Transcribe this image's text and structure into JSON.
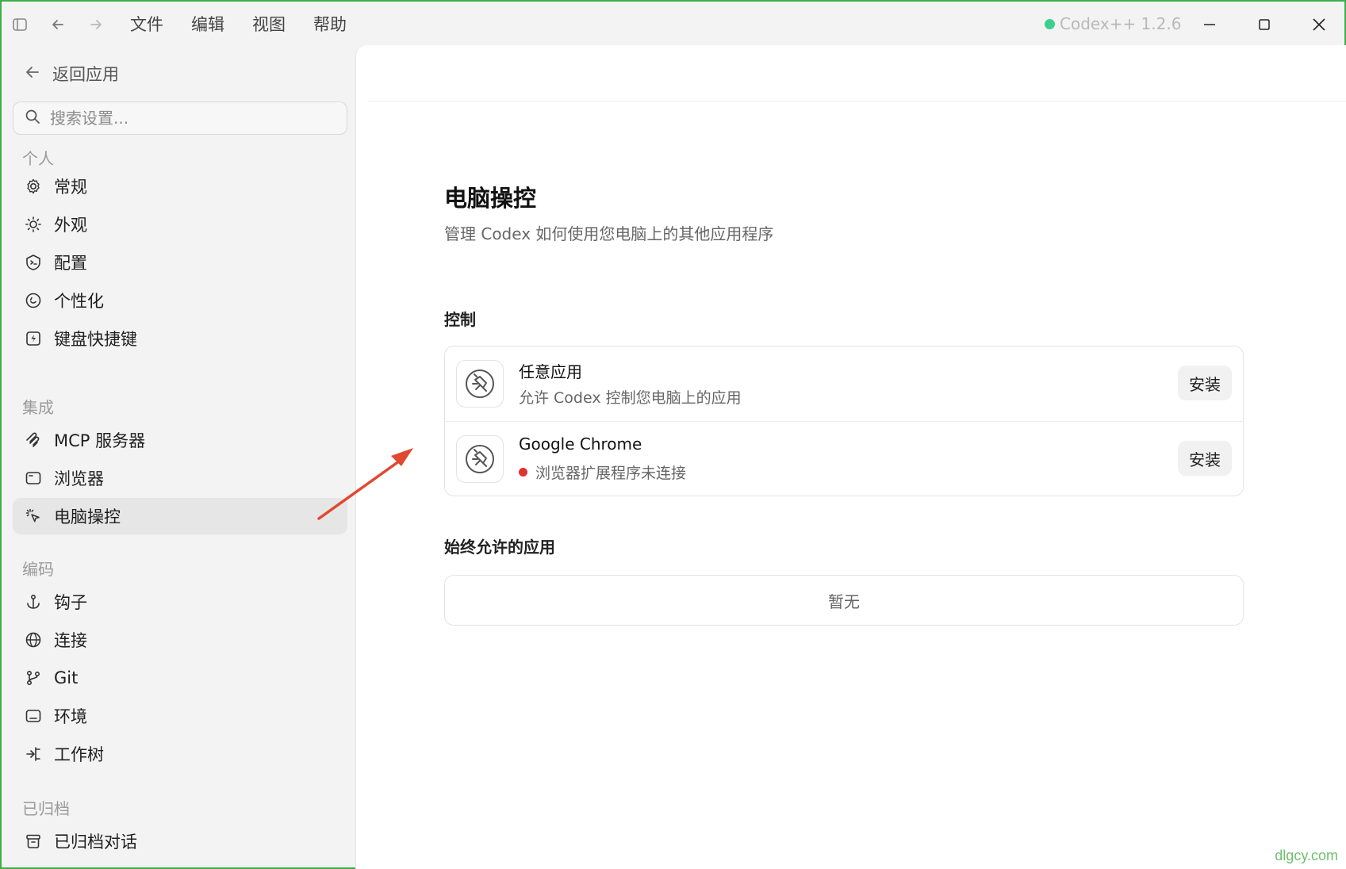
{
  "titlebar": {
    "menu": [
      "文件",
      "编辑",
      "视图",
      "帮助"
    ],
    "app_badge": "Codex++ 1.2.6",
    "badge_color": "#3ecf8e"
  },
  "sidebar": {
    "back_label": "返回应用",
    "search_placeholder": "搜索设置...",
    "sections": {
      "personal": "个人",
      "integration": "集成",
      "coding": "编码",
      "archived": "已归档"
    },
    "items": {
      "general": "常规",
      "appearance": "外观",
      "config": "配置",
      "personalize": "个性化",
      "shortcuts": "键盘快捷键",
      "mcp": "MCP 服务器",
      "browser": "浏览器",
      "computer_control": "电脑操控",
      "hooks": "钩子",
      "connections": "连接",
      "git": "Git",
      "environment": "环境",
      "worktree": "工作树",
      "archived_chats": "已归档对话"
    }
  },
  "main": {
    "title": "电脑操控",
    "subtitle": "管理 Codex 如何使用您电脑上的其他应用程序",
    "control_section": "控制",
    "control_rows": [
      {
        "name": "任意应用",
        "desc": "允许 Codex 控制您电脑上的应用",
        "button": "安装",
        "status": ""
      },
      {
        "name": "Google Chrome",
        "desc": "浏览器扩展程序未连接",
        "button": "安装",
        "status": "disconnected"
      }
    ],
    "always_allowed_section": "始终允许的应用",
    "always_allowed_empty": "暂无"
  },
  "watermark": "dlgcy.com",
  "colors": {
    "accent_green": "#3fae49",
    "annotation_arrow": "#e0492f",
    "status_red": "#e03131"
  }
}
